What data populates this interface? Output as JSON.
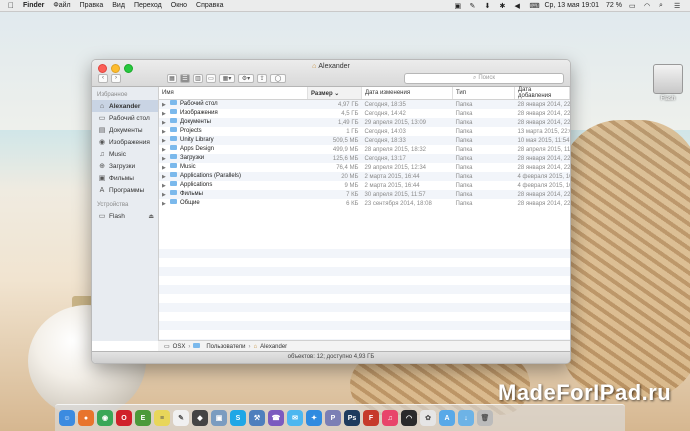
{
  "menubar": {
    "app": "Finder",
    "items": [
      "Файл",
      "Правка",
      "Вид",
      "Переход",
      "Окно",
      "Справка"
    ],
    "clock": "Ср, 13 мая  19:01",
    "battery": "72 %"
  },
  "desktop": {
    "drive_label": "Flash",
    "watermark": "MadeForIPad.ru"
  },
  "window": {
    "title": "Alexander",
    "search_placeholder": "Поиск",
    "sidebar": {
      "favorites_heading": "Избранное",
      "favorites": [
        {
          "label": "Alexander",
          "icon": "home-icon"
        },
        {
          "label": "Рабочий стол",
          "icon": "desktop-icon"
        },
        {
          "label": "Документы",
          "icon": "documents-icon"
        },
        {
          "label": "Изображения",
          "icon": "pictures-icon"
        },
        {
          "label": "Music",
          "icon": "music-icon"
        },
        {
          "label": "Загрузки",
          "icon": "downloads-icon"
        },
        {
          "label": "Фильмы",
          "icon": "movies-icon"
        },
        {
          "label": "Программы",
          "icon": "applications-icon"
        }
      ],
      "devices_heading": "Устройства",
      "devices": [
        {
          "label": "Flash",
          "icon": "drive-icon"
        }
      ]
    },
    "columns": {
      "name": "Имя",
      "size": "Размер",
      "date_modified": "Дата изменения",
      "kind": "Тип",
      "date_added": "Дата добавления"
    },
    "rows": [
      {
        "name": "Рабочий стол",
        "size": "4,97 ГБ",
        "modified": "Сегодня, 18:35",
        "kind": "Папка",
        "added": "28 января 2014, 22:07"
      },
      {
        "name": "Изображения",
        "size": "4,5 ГБ",
        "modified": "Сегодня, 14:42",
        "kind": "Папка",
        "added": "28 января 2014, 22:07"
      },
      {
        "name": "Документы",
        "size": "1,49 ГБ",
        "modified": "29 апреля 2015, 13:09",
        "kind": "Папка",
        "added": "28 января 2014, 22:07"
      },
      {
        "name": "Projects",
        "size": "1 ГБ",
        "modified": "Сегодня, 14:03",
        "kind": "Папка",
        "added": "13 марта 2015, 22:06"
      },
      {
        "name": "Unity Library",
        "size": "509,5 МБ",
        "modified": "Сегодня, 18:33",
        "kind": "Папка",
        "added": "10 мая 2015, 11:54"
      },
      {
        "name": "Apps Design",
        "size": "499,9 МБ",
        "modified": "28 апреля 2015, 18:32",
        "kind": "Папка",
        "added": "28 апреля 2015, 11:04"
      },
      {
        "name": "Загрузки",
        "size": "125,6 МБ",
        "modified": "Сегодня, 13:17",
        "kind": "Папка",
        "added": "28 января 2014, 22:07"
      },
      {
        "name": "Music",
        "size": "76,4 МБ",
        "modified": "29 апреля 2015, 12:34",
        "kind": "Папка",
        "added": "28 января 2014, 22:07"
      },
      {
        "name": "Applications (Parallels)",
        "size": "20 МБ",
        "modified": "2 марта 2015, 16:44",
        "kind": "Папка",
        "added": "4 февраля 2015, 16:51"
      },
      {
        "name": "Applications",
        "size": "9 МБ",
        "modified": "2 марта 2015, 16:44",
        "kind": "Папка",
        "added": "4 февраля 2015, 16:51"
      },
      {
        "name": "Фильмы",
        "size": "7 КБ",
        "modified": "30 апреля 2015, 11:57",
        "kind": "Папка",
        "added": "28 января 2014, 22:07"
      },
      {
        "name": "Общие",
        "size": "6 КБ",
        "modified": "23 сентября 2014, 18:08",
        "kind": "Папка",
        "added": "28 января 2014, 22:07"
      }
    ],
    "pathbar": [
      "OSX",
      "Пользователи",
      "Alexander"
    ],
    "status": "объектов: 12; доступно 4,93 ГБ"
  },
  "dock": {
    "apps": [
      {
        "icon": "finder-icon",
        "color": "#3b8be0",
        "glyph": "☺"
      },
      {
        "icon": "firefox-icon",
        "color": "#e8742c",
        "glyph": "●"
      },
      {
        "icon": "chrome-icon",
        "color": "#3aa757",
        "glyph": "◉"
      },
      {
        "icon": "opera-icon",
        "color": "#d0202a",
        "glyph": "O"
      },
      {
        "icon": "evernote-icon",
        "color": "#4c9a3a",
        "glyph": "E"
      },
      {
        "icon": "stickies-icon",
        "color": "#e8d65a",
        "glyph": "≡"
      },
      {
        "icon": "notes-icon",
        "color": "#f0f0f0",
        "glyph": "✎"
      },
      {
        "icon": "unity-icon",
        "color": "#444444",
        "glyph": "◆"
      },
      {
        "icon": "preview-icon",
        "color": "#7a9cc0",
        "glyph": "▣"
      },
      {
        "icon": "skype-icon",
        "color": "#1fa7e6",
        "glyph": "S"
      },
      {
        "icon": "xcode-icon",
        "color": "#4e7fbd",
        "glyph": "⚒"
      },
      {
        "icon": "viber-icon",
        "color": "#7b5bbf",
        "glyph": "☎"
      },
      {
        "icon": "messages-icon",
        "color": "#4cb7f0",
        "glyph": "✉"
      },
      {
        "icon": "safari-icon",
        "color": "#2f8be0",
        "glyph": "✦"
      },
      {
        "icon": "php-icon",
        "color": "#7b7fb5",
        "glyph": "P"
      },
      {
        "icon": "photoshop-icon",
        "color": "#1e3b5e",
        "glyph": "Ps"
      },
      {
        "icon": "filezilla-icon",
        "color": "#c63a2a",
        "glyph": "F"
      },
      {
        "icon": "itunes-icon",
        "color": "#e8456a",
        "glyph": "♫"
      },
      {
        "icon": "wifi-tool-icon",
        "color": "#2a2a2a",
        "glyph": "◠"
      },
      {
        "icon": "photos-icon",
        "color": "#e5e5e5",
        "glyph": "✿"
      },
      {
        "icon": "app-store-icon",
        "color": "#58a9e8",
        "glyph": "A"
      },
      {
        "icon": "downloads-stack-icon",
        "color": "#6db3e6",
        "glyph": "↓"
      },
      {
        "icon": "trash-icon",
        "color": "#bbbbbb",
        "glyph": "🗑"
      }
    ]
  }
}
